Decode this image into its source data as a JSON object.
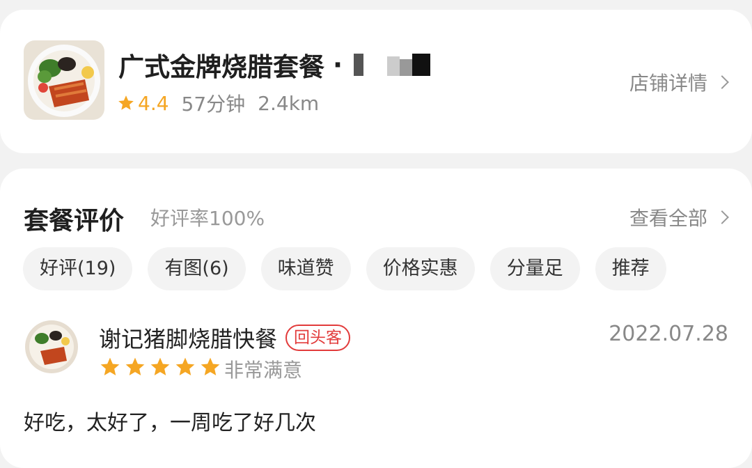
{
  "shop": {
    "name": "广式金牌烧腊套餐",
    "separator": "·",
    "rating": "4.4",
    "delivery_time": "57分钟",
    "distance": "2.4km",
    "detail_link": "店铺详情",
    "thumb_icon": "food-dish-image"
  },
  "reviews_section": {
    "title": "套餐评价",
    "positive_rate": "好评率100%",
    "see_all": "查看全部",
    "tags": [
      "好评(19)",
      "有图(6)",
      "味道赞",
      "价格实惠",
      "分量足",
      "推荐"
    ]
  },
  "review": {
    "reviewer": "谢记猪脚烧腊快餐",
    "badge": "回头客",
    "date": "2022.07.28",
    "stars": 5,
    "satisfaction": "非常满意",
    "text": "好吃，太好了，一周吃了好几次"
  },
  "colors": {
    "star": "#f5a623",
    "badge": "#e23b3b",
    "background": "#f2f2f2"
  }
}
